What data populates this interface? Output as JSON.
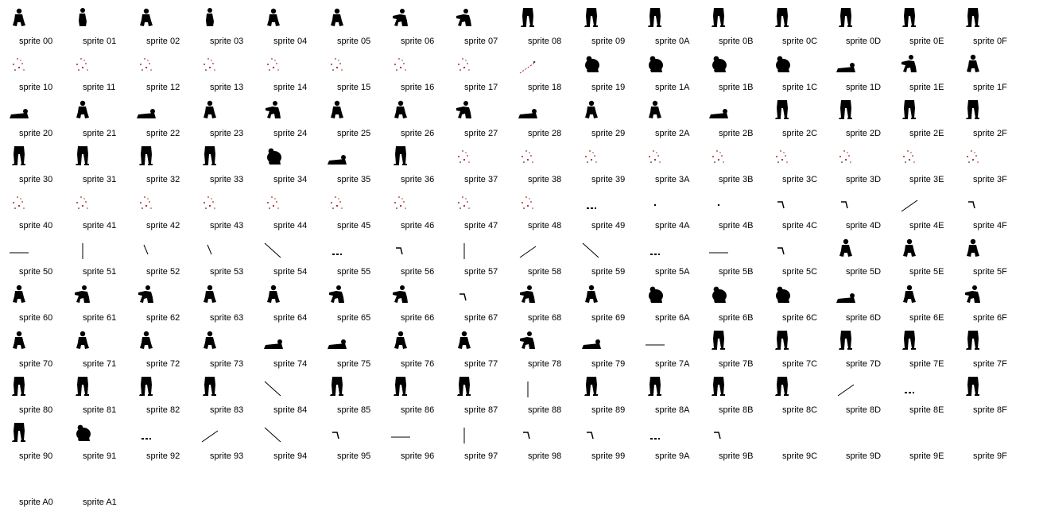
{
  "sprites": [
    {
      "label": "sprite 00",
      "icon": "figure-crouch"
    },
    {
      "label": "sprite 01",
      "icon": "figure-stand"
    },
    {
      "label": "sprite 02",
      "icon": "figure-crouch"
    },
    {
      "label": "sprite 03",
      "icon": "figure-stand"
    },
    {
      "label": "sprite 04",
      "icon": "figure-crouch"
    },
    {
      "label": "sprite 05",
      "icon": "figure-crouch"
    },
    {
      "label": "sprite 06",
      "icon": "figure-reach"
    },
    {
      "label": "sprite 07",
      "icon": "figure-reach"
    },
    {
      "label": "sprite 08",
      "icon": "legs"
    },
    {
      "label": "sprite 09",
      "icon": "legs"
    },
    {
      "label": "sprite 0A",
      "icon": "legs"
    },
    {
      "label": "sprite 0B",
      "icon": "legs"
    },
    {
      "label": "sprite 0C",
      "icon": "legs"
    },
    {
      "label": "sprite 0D",
      "icon": "legs"
    },
    {
      "label": "sprite 0E",
      "icon": "legs"
    },
    {
      "label": "sprite 0F",
      "icon": "legs"
    },
    {
      "label": "sprite 10",
      "icon": "sparks"
    },
    {
      "label": "sprite 11",
      "icon": "sparks"
    },
    {
      "label": "sprite 12",
      "icon": "sparks"
    },
    {
      "label": "sprite 13",
      "icon": "sparks"
    },
    {
      "label": "sprite 14",
      "icon": "sparks"
    },
    {
      "label": "sprite 15",
      "icon": "sparks"
    },
    {
      "label": "sprite 16",
      "icon": "sparks"
    },
    {
      "label": "sprite 17",
      "icon": "sparks"
    },
    {
      "label": "sprite 18",
      "icon": "sparks-diag"
    },
    {
      "label": "sprite 19",
      "icon": "figure-ball"
    },
    {
      "label": "sprite 1A",
      "icon": "figure-ball"
    },
    {
      "label": "sprite 1B",
      "icon": "figure-ball"
    },
    {
      "label": "sprite 1C",
      "icon": "figure-ball"
    },
    {
      "label": "sprite 1D",
      "icon": "figure-lying"
    },
    {
      "label": "sprite 1E",
      "icon": "figure-reach"
    },
    {
      "label": "sprite 1F",
      "icon": "figure-crouch"
    },
    {
      "label": "sprite 20",
      "icon": "figure-lying"
    },
    {
      "label": "sprite 21",
      "icon": "figure-crouch"
    },
    {
      "label": "sprite 22",
      "icon": "figure-lying"
    },
    {
      "label": "sprite 23",
      "icon": "figure-crouch"
    },
    {
      "label": "sprite 24",
      "icon": "figure-reach"
    },
    {
      "label": "sprite 25",
      "icon": "figure-crouch"
    },
    {
      "label": "sprite 26",
      "icon": "figure-crouch"
    },
    {
      "label": "sprite 27",
      "icon": "figure-reach"
    },
    {
      "label": "sprite 28",
      "icon": "figure-lying"
    },
    {
      "label": "sprite 29",
      "icon": "figure-crouch"
    },
    {
      "label": "sprite 2A",
      "icon": "figure-crouch"
    },
    {
      "label": "sprite 2B",
      "icon": "figure-lying"
    },
    {
      "label": "sprite 2C",
      "icon": "legs"
    },
    {
      "label": "sprite 2D",
      "icon": "legs"
    },
    {
      "label": "sprite 2E",
      "icon": "legs"
    },
    {
      "label": "sprite 2F",
      "icon": "legs"
    },
    {
      "label": "sprite 30",
      "icon": "legs"
    },
    {
      "label": "sprite 31",
      "icon": "legs"
    },
    {
      "label": "sprite 32",
      "icon": "legs"
    },
    {
      "label": "sprite 33",
      "icon": "legs"
    },
    {
      "label": "sprite 34",
      "icon": "figure-ball"
    },
    {
      "label": "sprite 35",
      "icon": "figure-lying"
    },
    {
      "label": "sprite 36",
      "icon": "legs"
    },
    {
      "label": "sprite 37",
      "icon": "sparks"
    },
    {
      "label": "sprite 38",
      "icon": "sparks"
    },
    {
      "label": "sprite 39",
      "icon": "sparks"
    },
    {
      "label": "sprite 3A",
      "icon": "sparks"
    },
    {
      "label": "sprite 3B",
      "icon": "sparks"
    },
    {
      "label": "sprite 3C",
      "icon": "sparks"
    },
    {
      "label": "sprite 3D",
      "icon": "sparks"
    },
    {
      "label": "sprite 3E",
      "icon": "sparks"
    },
    {
      "label": "sprite 3F",
      "icon": "sparks"
    },
    {
      "label": "sprite 40",
      "icon": "sparks"
    },
    {
      "label": "sprite 41",
      "icon": "sparks"
    },
    {
      "label": "sprite 42",
      "icon": "sparks"
    },
    {
      "label": "sprite 43",
      "icon": "sparks"
    },
    {
      "label": "sprite 44",
      "icon": "sparks"
    },
    {
      "label": "sprite 45",
      "icon": "sparks"
    },
    {
      "label": "sprite 46",
      "icon": "sparks"
    },
    {
      "label": "sprite 47",
      "icon": "sparks"
    },
    {
      "label": "sprite 48",
      "icon": "sparks"
    },
    {
      "label": "sprite 49",
      "icon": "dash"
    },
    {
      "label": "sprite 4A",
      "icon": "dot"
    },
    {
      "label": "sprite 4B",
      "icon": "dot"
    },
    {
      "label": "sprite 4C",
      "icon": "corner"
    },
    {
      "label": "sprite 4D",
      "icon": "corner"
    },
    {
      "label": "sprite 4E",
      "icon": "line-rise"
    },
    {
      "label": "sprite 4F",
      "icon": "corner"
    },
    {
      "label": "sprite 50",
      "icon": "line-h"
    },
    {
      "label": "sprite 51",
      "icon": "line-v"
    },
    {
      "label": "sprite 52",
      "icon": "line-steep"
    },
    {
      "label": "sprite 53",
      "icon": "line-steep"
    },
    {
      "label": "sprite 54",
      "icon": "line-fall"
    },
    {
      "label": "sprite 55",
      "icon": "dash"
    },
    {
      "label": "sprite 56",
      "icon": "corner"
    },
    {
      "label": "sprite 57",
      "icon": "line-v"
    },
    {
      "label": "sprite 58",
      "icon": "line-rise"
    },
    {
      "label": "sprite 59",
      "icon": "line-fall"
    },
    {
      "label": "sprite 5A",
      "icon": "dash"
    },
    {
      "label": "sprite 5B",
      "icon": "line-h"
    },
    {
      "label": "sprite 5C",
      "icon": "corner"
    },
    {
      "label": "sprite 5D",
      "icon": "figure-crouch"
    },
    {
      "label": "sprite 5E",
      "icon": "figure-crouch"
    },
    {
      "label": "sprite 5F",
      "icon": "figure-crouch"
    },
    {
      "label": "sprite 60",
      "icon": "figure-crouch"
    },
    {
      "label": "sprite 61",
      "icon": "figure-reach"
    },
    {
      "label": "sprite 62",
      "icon": "figure-reach"
    },
    {
      "label": "sprite 63",
      "icon": "figure-crouch"
    },
    {
      "label": "sprite 64",
      "icon": "figure-crouch"
    },
    {
      "label": "sprite 65",
      "icon": "figure-reach"
    },
    {
      "label": "sprite 66",
      "icon": "figure-reach"
    },
    {
      "label": "sprite 67",
      "icon": "corner"
    },
    {
      "label": "sprite 68",
      "icon": "figure-reach"
    },
    {
      "label": "sprite 69",
      "icon": "figure-crouch"
    },
    {
      "label": "sprite 6A",
      "icon": "figure-ball"
    },
    {
      "label": "sprite 6B",
      "icon": "figure-ball"
    },
    {
      "label": "sprite 6C",
      "icon": "figure-ball"
    },
    {
      "label": "sprite 6D",
      "icon": "figure-lying"
    },
    {
      "label": "sprite 6E",
      "icon": "figure-crouch"
    },
    {
      "label": "sprite 6F",
      "icon": "figure-reach"
    },
    {
      "label": "sprite 70",
      "icon": "figure-crouch"
    },
    {
      "label": "sprite 71",
      "icon": "figure-crouch"
    },
    {
      "label": "sprite 72",
      "icon": "figure-crouch"
    },
    {
      "label": "sprite 73",
      "icon": "figure-crouch"
    },
    {
      "label": "sprite 74",
      "icon": "figure-lying"
    },
    {
      "label": "sprite 75",
      "icon": "figure-lying"
    },
    {
      "label": "sprite 76",
      "icon": "figure-crouch"
    },
    {
      "label": "sprite 77",
      "icon": "figure-crouch"
    },
    {
      "label": "sprite 78",
      "icon": "figure-reach"
    },
    {
      "label": "sprite 79",
      "icon": "figure-lying"
    },
    {
      "label": "sprite 7A",
      "icon": "line-h"
    },
    {
      "label": "sprite 7B",
      "icon": "legs"
    },
    {
      "label": "sprite 7C",
      "icon": "legs"
    },
    {
      "label": "sprite 7D",
      "icon": "legs"
    },
    {
      "label": "sprite 7E",
      "icon": "legs"
    },
    {
      "label": "sprite 7F",
      "icon": "legs"
    },
    {
      "label": "sprite 80",
      "icon": "legs"
    },
    {
      "label": "sprite 81",
      "icon": "legs"
    },
    {
      "label": "sprite 82",
      "icon": "legs"
    },
    {
      "label": "sprite 83",
      "icon": "legs"
    },
    {
      "label": "sprite 84",
      "icon": "line-fall"
    },
    {
      "label": "sprite 85",
      "icon": "legs"
    },
    {
      "label": "sprite 86",
      "icon": "legs"
    },
    {
      "label": "sprite 87",
      "icon": "legs"
    },
    {
      "label": "sprite 88",
      "icon": "line-v"
    },
    {
      "label": "sprite 89",
      "icon": "legs"
    },
    {
      "label": "sprite 8A",
      "icon": "legs"
    },
    {
      "label": "sprite 8B",
      "icon": "legs"
    },
    {
      "label": "sprite 8C",
      "icon": "legs"
    },
    {
      "label": "sprite 8D",
      "icon": "line-rise"
    },
    {
      "label": "sprite 8E",
      "icon": "dash"
    },
    {
      "label": "sprite 8F",
      "icon": "legs"
    },
    {
      "label": "sprite 90",
      "icon": "legs"
    },
    {
      "label": "sprite 91",
      "icon": "figure-ball"
    },
    {
      "label": "sprite 92",
      "icon": "dash"
    },
    {
      "label": "sprite 93",
      "icon": "line-rise"
    },
    {
      "label": "sprite 94",
      "icon": "line-fall"
    },
    {
      "label": "sprite 95",
      "icon": "corner"
    },
    {
      "label": "sprite 96",
      "icon": "line-h"
    },
    {
      "label": "sprite 97",
      "icon": "line-v"
    },
    {
      "label": "sprite 98",
      "icon": "corner"
    },
    {
      "label": "sprite 99",
      "icon": "corner"
    },
    {
      "label": "sprite 9A",
      "icon": "dash"
    },
    {
      "label": "sprite 9B",
      "icon": "corner"
    },
    {
      "label": "sprite 9C",
      "icon": "empty"
    },
    {
      "label": "sprite 9D",
      "icon": "empty"
    },
    {
      "label": "sprite 9E",
      "icon": "empty"
    },
    {
      "label": "sprite 9F",
      "icon": "empty"
    },
    {
      "label": "sprite A0",
      "icon": "empty"
    },
    {
      "label": "sprite A1",
      "icon": "empty"
    }
  ],
  "colors": {
    "ink": "#000000",
    "spark": "#b02020",
    "background": "#ffffff"
  }
}
